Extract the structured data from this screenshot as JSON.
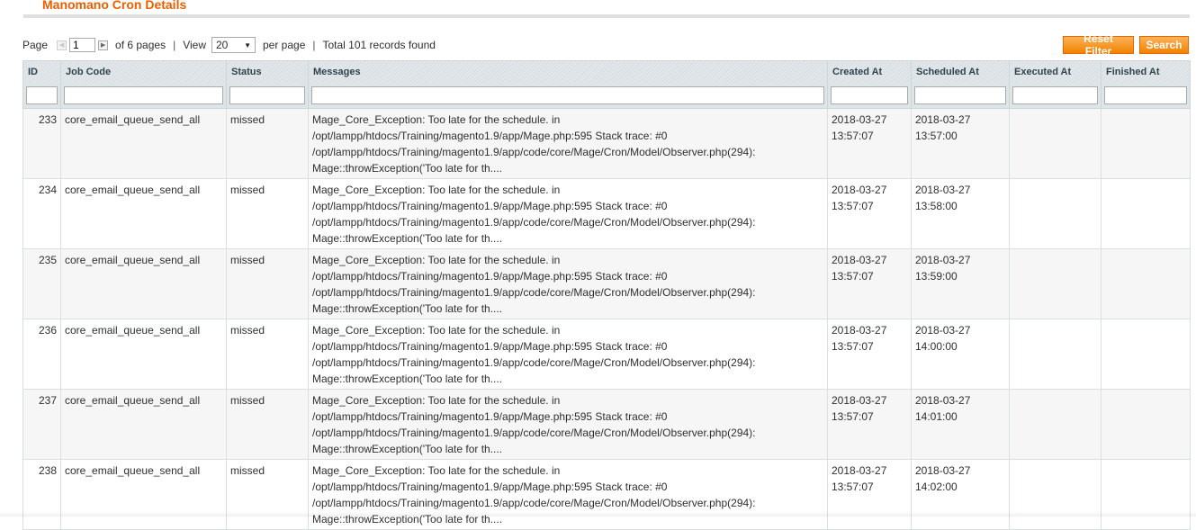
{
  "header": {
    "title": "Manomano Cron Details"
  },
  "pager": {
    "page_label": "Page",
    "current_page": "1",
    "of_pages": "of 6 pages",
    "view_label": "View",
    "per_page_value": "20",
    "per_page_label": "per page",
    "total_records": "Total 101 records found"
  },
  "actions": {
    "reset_filter": "Reset Filter",
    "search": "Search"
  },
  "colors": {
    "accent": "#eb5e00",
    "button": "#f18200"
  },
  "grid": {
    "columns": [
      "ID",
      "Job Code",
      "Status",
      "Messages",
      "Created At",
      "Scheduled At",
      "Executed At",
      "Finished At"
    ],
    "rows": [
      {
        "id": "233",
        "job_code": "core_email_queue_send_all",
        "status": "missed",
        "message": "Mage_Core_Exception: Too late for the schedule. in /opt/lampp/htdocs/Training/magento1.9/app/Mage.php:595 Stack trace: #0 /opt/lampp/htdocs/Training/magento1.9/app/code/core/Mage/Cron/Model/Observer.php(294): Mage::throwException('Too late for th....",
        "created_at": "2018-03-27 13:57:07",
        "scheduled_at": "2018-03-27 13:57:00",
        "executed_at": "",
        "finished_at": ""
      },
      {
        "id": "234",
        "job_code": "core_email_queue_send_all",
        "status": "missed",
        "message": "Mage_Core_Exception: Too late for the schedule. in /opt/lampp/htdocs/Training/magento1.9/app/Mage.php:595 Stack trace: #0 /opt/lampp/htdocs/Training/magento1.9/app/code/core/Mage/Cron/Model/Observer.php(294): Mage::throwException('Too late for th....",
        "created_at": "2018-03-27 13:57:07",
        "scheduled_at": "2018-03-27 13:58:00",
        "executed_at": "",
        "finished_at": ""
      },
      {
        "id": "235",
        "job_code": "core_email_queue_send_all",
        "status": "missed",
        "message": "Mage_Core_Exception: Too late for the schedule. in /opt/lampp/htdocs/Training/magento1.9/app/Mage.php:595 Stack trace: #0 /opt/lampp/htdocs/Training/magento1.9/app/code/core/Mage/Cron/Model/Observer.php(294): Mage::throwException('Too late for th....",
        "created_at": "2018-03-27 13:57:07",
        "scheduled_at": "2018-03-27 13:59:00",
        "executed_at": "",
        "finished_at": ""
      },
      {
        "id": "236",
        "job_code": "core_email_queue_send_all",
        "status": "missed",
        "message": "Mage_Core_Exception: Too late for the schedule. in /opt/lampp/htdocs/Training/magento1.9/app/Mage.php:595 Stack trace: #0 /opt/lampp/htdocs/Training/magento1.9/app/code/core/Mage/Cron/Model/Observer.php(294): Mage::throwException('Too late for th....",
        "created_at": "2018-03-27 13:57:07",
        "scheduled_at": "2018-03-27 14:00:00",
        "executed_at": "",
        "finished_at": ""
      },
      {
        "id": "237",
        "job_code": "core_email_queue_send_all",
        "status": "missed",
        "message": "Mage_Core_Exception: Too late for the schedule. in /opt/lampp/htdocs/Training/magento1.9/app/Mage.php:595 Stack trace: #0 /opt/lampp/htdocs/Training/magento1.9/app/code/core/Mage/Cron/Model/Observer.php(294): Mage::throwException('Too late for th....",
        "created_at": "2018-03-27 13:57:07",
        "scheduled_at": "2018-03-27 14:01:00",
        "executed_at": "",
        "finished_at": ""
      },
      {
        "id": "238",
        "job_code": "core_email_queue_send_all",
        "status": "missed",
        "message": "Mage_Core_Exception: Too late for the schedule. in /opt/lampp/htdocs/Training/magento1.9/app/Mage.php:595 Stack trace: #0 /opt/lampp/htdocs/Training/magento1.9/app/code/core/Mage/Cron/Model/Observer.php(294): Mage::throwException('Too late for th....",
        "created_at": "2018-03-27 13:57:07",
        "scheduled_at": "2018-03-27 14:02:00",
        "executed_at": "",
        "finished_at": ""
      }
    ]
  }
}
